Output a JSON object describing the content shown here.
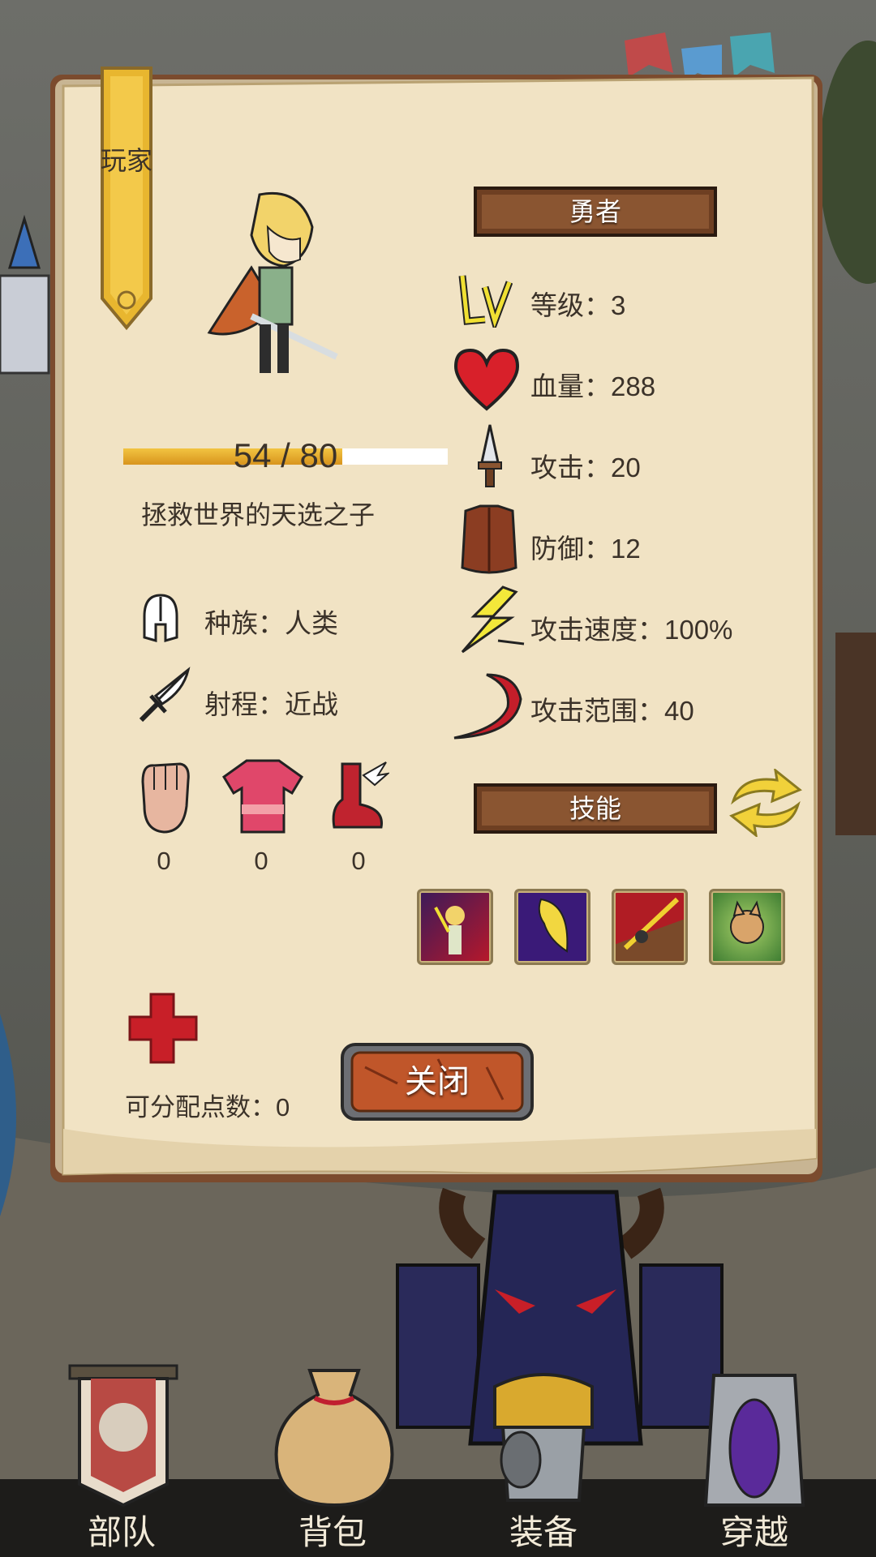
{
  "player_tab": "玩家",
  "hero": {
    "class_name": "勇者",
    "exp_current": 54,
    "exp_max": 80,
    "exp_text": "54 / 80",
    "title": "拯救世界的天选之子",
    "race": "种族：人类",
    "range": "射程：近战"
  },
  "stats": {
    "level": "等级：3",
    "hp": "血量：288",
    "attack": "攻击：20",
    "defense": "防御：12",
    "attack_speed": "攻击速度：100%",
    "attack_range": "攻击范围：40"
  },
  "equipment_counts": [
    "0",
    "0",
    "0"
  ],
  "skills_header": "技能",
  "skill_icons": [
    "hero-sword-skill-icon",
    "blonde-hair-skill-icon",
    "spear-strike-skill-icon",
    "forest-cat-skill-icon"
  ],
  "points": "可分配点数：0",
  "close_label": "关闭",
  "nav": [
    "部队",
    "背包",
    "装备",
    "穿越"
  ],
  "colors": {
    "parchment": "#f1e3c4",
    "wood_plate": "#7a4a2b",
    "exp_fill": "#e9b233",
    "heart": "#d8202a",
    "plus": "#c81f28",
    "nav_bar": "#1d1c1a"
  }
}
